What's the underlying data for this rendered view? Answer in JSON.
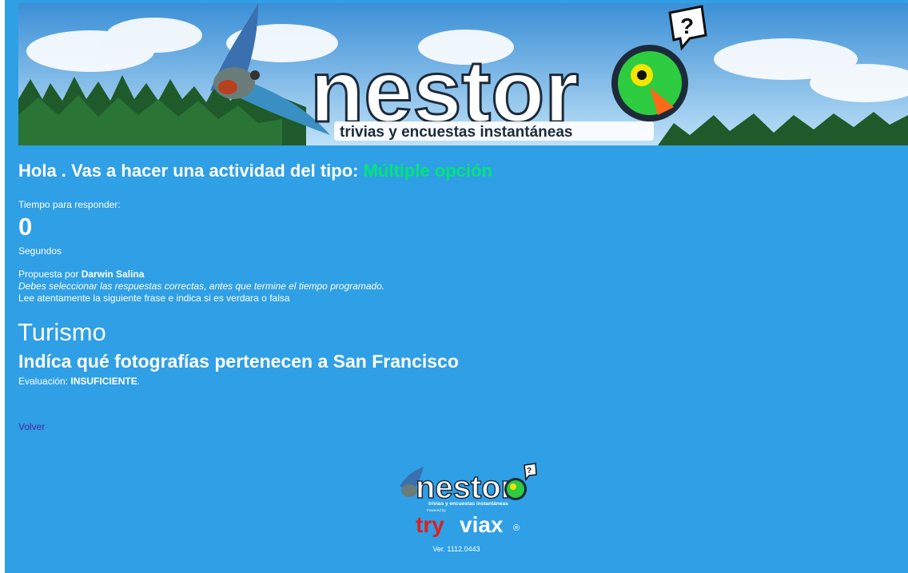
{
  "banner": {
    "logo_text": "nestor",
    "logo_subtitle": "trivias y encuestas instantáneas"
  },
  "greeting": {
    "prefix": "Hola . Vas a hacer una actividad del tipo: ",
    "type": "Múltiple opción"
  },
  "timer": {
    "label": "Tiempo para responder:",
    "value": "0",
    "unit": "Segundos"
  },
  "author": {
    "prefix": "Propuesta por ",
    "name": "Darwin Salina"
  },
  "instructions": "Debes seleccionar las respuestas correctas, antes que termine el tiempo programado.",
  "hint": "Lee atentamente la siguiente frase e indica si es verdara o falsa",
  "category": "Turismo",
  "question": "Indíca qué fotografías pertenecen a San Francisco",
  "evaluation": {
    "prefix": "Evaluación: ",
    "result": "INSUFICIENTE",
    "suffix": "."
  },
  "back_link": "Volver",
  "footer": {
    "logo_text": "nestor",
    "logo_subtitle": "trivias y encuestas instantáneas",
    "powered_by": "Powered by",
    "brand_try": "try",
    "brand_viax": "viax",
    "registered": "®",
    "version": "Ver. 1112.0443"
  },
  "colors": {
    "background": "#2f9fe6",
    "accent_green": "#00e676",
    "link": "#4a2a9a",
    "brand_red": "#e01e1e"
  }
}
